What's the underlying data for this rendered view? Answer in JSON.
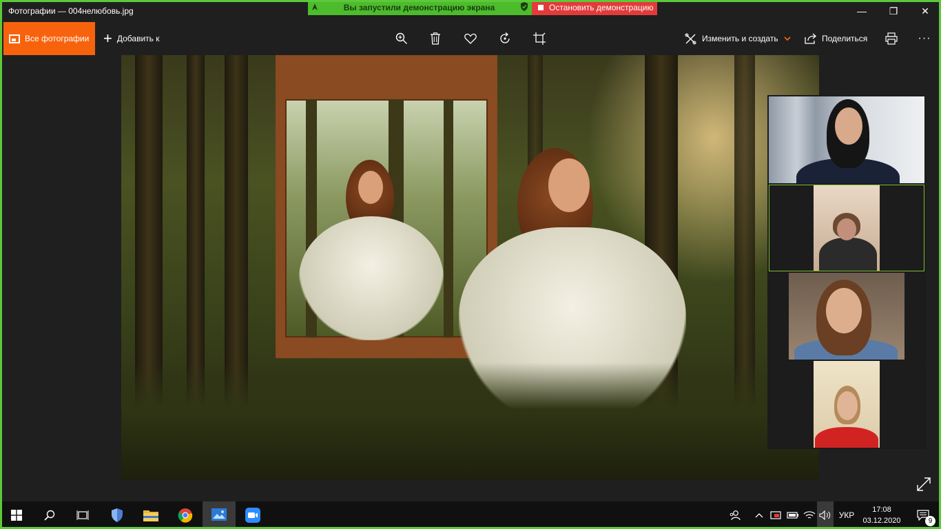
{
  "window": {
    "title": "Фотографии — 004нелюбовь.jpg",
    "minimize": "—",
    "maximize": "❐",
    "close": "✕"
  },
  "share_banner": {
    "status_text": "Вы запустили демонстрацию экрана",
    "stop_label": "Остановить демонстрацию"
  },
  "toolbar": {
    "all_photos_label": "Все фотографии",
    "add_to_label": "Добавить к",
    "add_to_plus": "+",
    "edit_create_label": "Изменить и создать",
    "share_label": "Поделиться",
    "more_label": "···"
  },
  "colors": {
    "accent_orange": "#f7630c",
    "share_green": "#4cbb2c",
    "stop_red": "#e23b3b",
    "active_speaker": "#7fbf2f"
  },
  "icons": {
    "zoom": "zoom-in-icon",
    "delete": "trash-icon",
    "favorite": "heart-icon",
    "rotate": "rotate-icon",
    "crop": "crop-icon",
    "edit": "edit-create-icon",
    "share": "share-icon",
    "print": "printer-icon",
    "expand": "expand-icon"
  },
  "taskbar": {
    "language": "УКР",
    "time": "17:08",
    "date": "03.12.2020",
    "notification_count": "9"
  }
}
